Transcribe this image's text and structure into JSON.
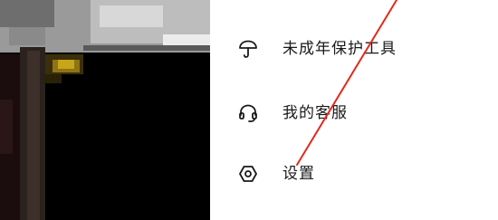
{
  "menu": {
    "items": [
      {
        "label": "未成年保护工具",
        "icon": "umbrella-icon"
      },
      {
        "label": "我的客服",
        "icon": "headset-icon"
      },
      {
        "label": "设置",
        "icon": "hexagon-settings-icon"
      }
    ]
  },
  "colors": {
    "text": "#1a1a1a",
    "annotation_line": "#e5281e",
    "background": "#ffffff"
  }
}
